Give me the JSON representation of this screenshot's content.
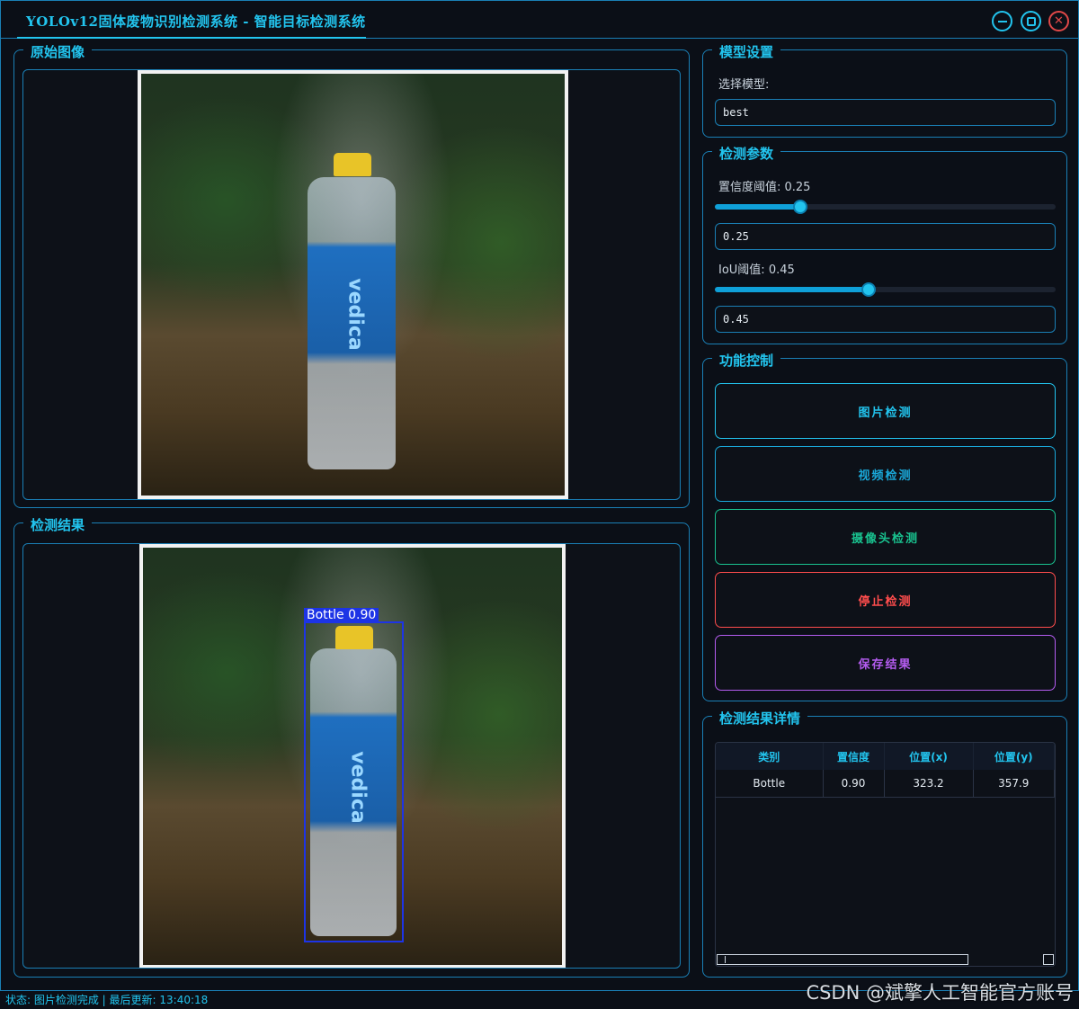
{
  "window": {
    "title": "YOLOv12固体废物识别检测系统 - 智能目标检测系统"
  },
  "colors": {
    "accent": "#22c4ee",
    "border": "#1a7fb5",
    "background": "#0b0f17",
    "image_detection": "#22c4ee",
    "video_detection": "#1aa7d8",
    "camera_detection": "#19c28f",
    "stop_detection": "#ff4d4d",
    "save_results": "#b45cf0",
    "detection_box": "#1d34e6"
  },
  "original_image": {
    "title": "原始图像",
    "bottle_brand": "vedica"
  },
  "detection_result": {
    "title": "检测结果",
    "bottle_brand": "vedica",
    "box_label": "Bottle  0.90"
  },
  "model_settings": {
    "title": "模型设置",
    "select_label": "选择模型:",
    "selected_model": "best"
  },
  "detection_params": {
    "title": "检测参数",
    "confidence_label": "置信度阈值: 0.25",
    "confidence_value": "0.25",
    "confidence_level": 0.25,
    "iou_label": "IoU阈值: 0.45",
    "iou_value": "0.45",
    "iou_level": 0.45
  },
  "function_control": {
    "title": "功能控制",
    "image_detection": "图片检测",
    "video_detection": "视频检测",
    "camera_detection": "摄像头检测",
    "stop_detection": "停止检测",
    "save_results": "保存结果"
  },
  "results_detail": {
    "title": "检测结果详情",
    "columns": [
      "类别",
      "置信度",
      "位置(x)",
      "位置(y)"
    ],
    "rows": [
      [
        "Bottle",
        "0.90",
        "323.2",
        "357.9"
      ]
    ]
  },
  "statusbar": {
    "text": "状态: 图片检测完成 | 最后更新: 13:40:18"
  },
  "watermark": "CSDN @斌擎人工智能官方账号"
}
